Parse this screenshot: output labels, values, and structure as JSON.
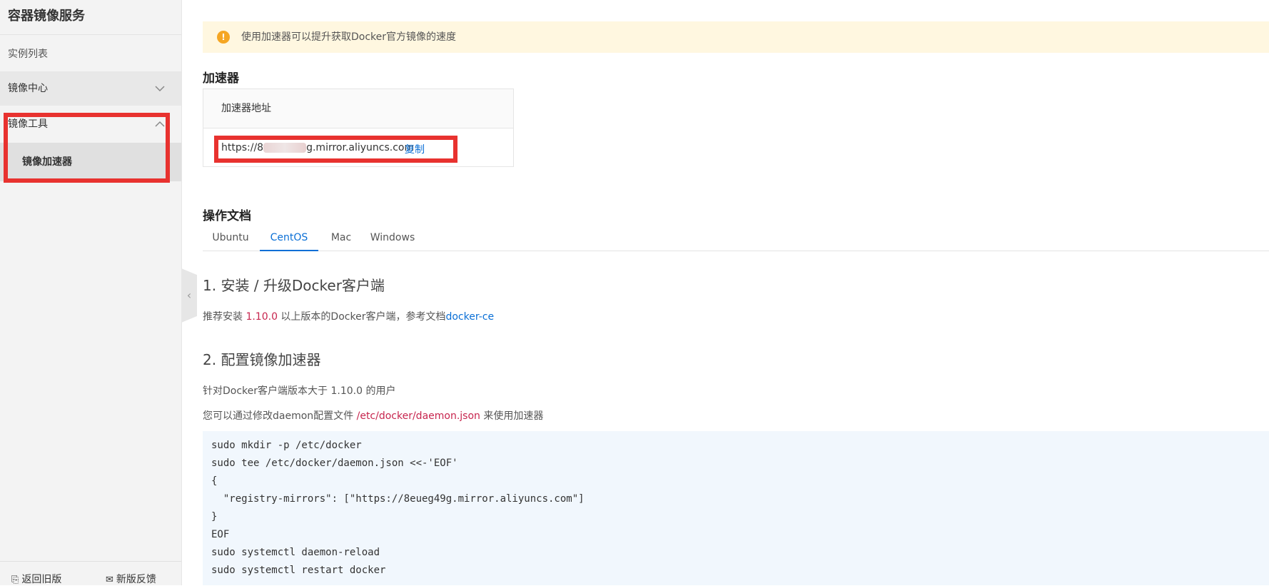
{
  "sidebar": {
    "title": "容器镜像服务",
    "items": [
      {
        "label": "实例列表"
      },
      {
        "label": "镜像中心"
      },
      {
        "label": "镜像工具"
      }
    ],
    "sub_item": "镜像加速器",
    "footer": {
      "back_label": "返回旧版",
      "feedback_label": "新版反馈"
    }
  },
  "notice": {
    "text": "使用加速器可以提升获取Docker官方镜像的速度"
  },
  "accelerator": {
    "heading": "加速器",
    "column_header": "加速器地址",
    "url_prefix": "https://8",
    "url_suffix": "g.mirror.aliyuncs.com",
    "copy_label": "复制"
  },
  "docs": {
    "heading": "操作文档",
    "tabs": [
      "Ubuntu",
      "CentOS",
      "Mac",
      "Windows"
    ],
    "active_tab": "CentOS",
    "step1_title": "1. 安装 / 升级Docker客户端",
    "step1_p_before": "推荐安装 ",
    "step1_version": "1.10.0",
    "step1_p_after": " 以上版本的Docker客户端，参考文档",
    "step1_link": "docker-ce",
    "step2_title": "2. 配置镜像加速器",
    "step2_p1": "针对Docker客户端版本大于 1.10.0 的用户",
    "step2_p2_before": "您可以通过修改daemon配置文件 ",
    "step2_path": "/etc/docker/daemon.json",
    "step2_p2_after": " 来使用加速器",
    "code_lines": [
      "sudo mkdir -p /etc/docker",
      "sudo tee /etc/docker/daemon.json <<-'EOF'",
      "{",
      "  \"registry-mirrors\": [\"https://8eueg49g.mirror.aliyuncs.com\"]",
      "}",
      "EOF",
      "sudo systemctl daemon-reload",
      "sudo systemctl restart docker"
    ]
  },
  "colors": {
    "highlight": "#e8322f",
    "link": "#0a6fd6",
    "notice_bg": "#fff7e0",
    "code_bg": "#f1f7fd"
  }
}
